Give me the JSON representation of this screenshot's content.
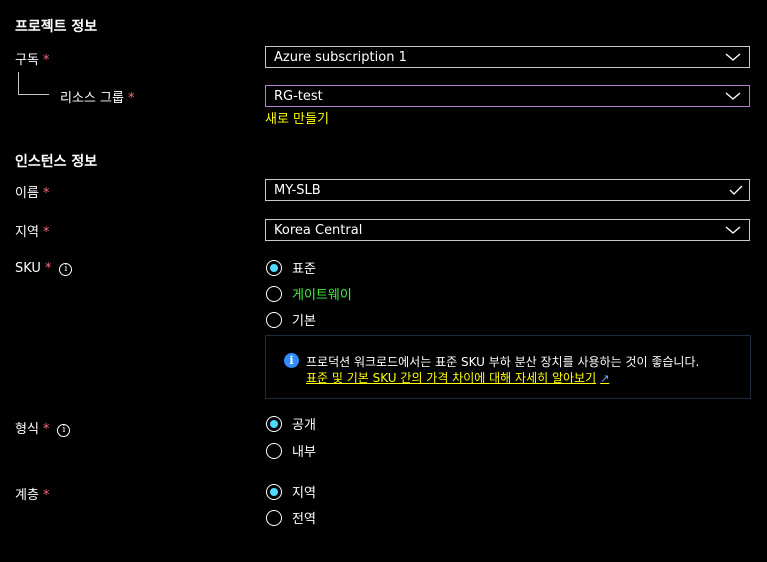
{
  "project": {
    "title": "프로젝트 정보",
    "subscription": {
      "label": "구독",
      "required": "*",
      "value": "Azure subscription 1"
    },
    "resource_group": {
      "label": "리소스 그룹",
      "required": "*",
      "value": "RG-test",
      "create_new": "새로 만들기"
    }
  },
  "instance": {
    "title": "인스턴스 정보",
    "name": {
      "label": "이름",
      "required": "*",
      "value": "MY-SLB"
    },
    "region": {
      "label": "지역",
      "required": "*",
      "value": "Korea Central"
    },
    "sku": {
      "label": "SKU",
      "required": "*",
      "info_icon": "i",
      "options": [
        "표준",
        "게이트웨이",
        "기본"
      ],
      "selected": "표준",
      "info_message": "프로덕션 워크로드에서는 표준 SKU 부하 분산 장치를 사용하는 것이 좋습니다.",
      "info_link": "표준 및 기본 SKU 간의 가격 차이에 대해 자세히 알아보기",
      "info_icon_glyph": "i",
      "external_icon": "↗"
    },
    "type": {
      "label": "형식",
      "required": "*",
      "info_icon": "i",
      "options": [
        "공개",
        "내부"
      ],
      "selected": "공개"
    },
    "tier": {
      "label": "계층",
      "required": "*",
      "options": [
        "지역",
        "전역"
      ],
      "selected": "지역"
    }
  },
  "colors": {
    "background": "#000000",
    "required": "#f1707b",
    "radio_selected": "#4fd9ff",
    "link": "#ffff00",
    "green_text": "#3ff23f",
    "focus_border": "#b37ed4",
    "info_icon": "#2f8dff"
  }
}
